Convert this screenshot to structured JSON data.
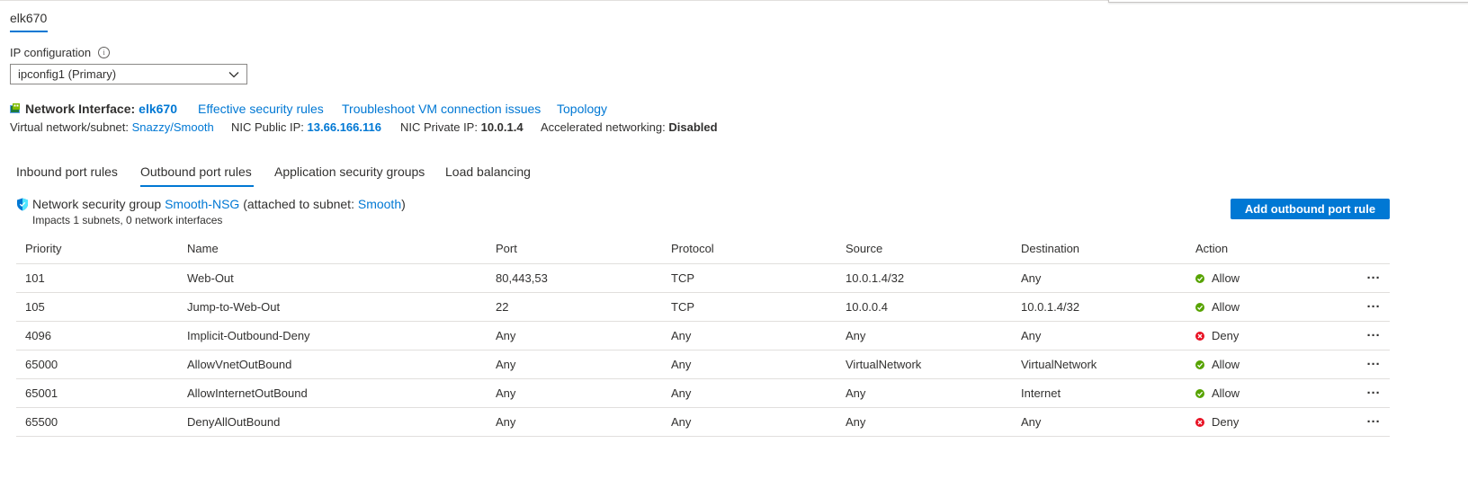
{
  "nic_tab": "elk670",
  "ip_config": {
    "label": "IP configuration",
    "selected": "ipconfig1 (Primary)"
  },
  "nic": {
    "label": "Network Interface:",
    "name": "elk670",
    "links": [
      "Effective security rules",
      "Troubleshoot VM connection issues",
      "Topology"
    ],
    "vnet_label": "Virtual network/subnet:",
    "vnet_value": "Snazzy/Smooth",
    "public_ip_label": "NIC Public IP:",
    "public_ip_value": "13.66.166.116",
    "private_ip_label": "NIC Private IP:",
    "private_ip_value": "10.0.1.4",
    "accel_label": "Accelerated networking:",
    "accel_value": "Disabled"
  },
  "tabs": [
    {
      "label": "Inbound port rules",
      "active": false
    },
    {
      "label": "Outbound port rules",
      "active": true
    },
    {
      "label": "Application security groups",
      "active": false
    },
    {
      "label": "Load balancing",
      "active": false
    }
  ],
  "nsg": {
    "prefix": "Network security group",
    "name": "Smooth-NSG",
    "attached_prefix": "(attached to subnet:",
    "subnet": "Smooth",
    "attached_suffix": ")",
    "impacts": "Impacts 1 subnets, 0 network interfaces"
  },
  "add_button": "Add outbound port rule",
  "table": {
    "headers": [
      "Priority",
      "Name",
      "Port",
      "Protocol",
      "Source",
      "Destination",
      "Action"
    ],
    "rows": [
      {
        "priority": "101",
        "name": "Web-Out",
        "port": "80,443,53",
        "protocol": "TCP",
        "source": "10.0.1.4/32",
        "destination": "Any",
        "action": "Allow",
        "more": "···"
      },
      {
        "priority": "105",
        "name": "Jump-to-Web-Out",
        "port": "22",
        "protocol": "TCP",
        "source": "10.0.0.4",
        "destination": "10.0.1.4/32",
        "action": "Allow",
        "more": "···"
      },
      {
        "priority": "4096",
        "name": "Implicit-Outbound-Deny",
        "port": "Any",
        "protocol": "Any",
        "source": "Any",
        "destination": "Any",
        "action": "Deny",
        "more": "···"
      },
      {
        "priority": "65000",
        "name": "AllowVnetOutBound",
        "port": "Any",
        "protocol": "Any",
        "source": "VirtualNetwork",
        "destination": "VirtualNetwork",
        "action": "Allow",
        "more": "···"
      },
      {
        "priority": "65001",
        "name": "AllowInternetOutBound",
        "port": "Any",
        "protocol": "Any",
        "source": "Any",
        "destination": "Internet",
        "action": "Allow",
        "more": "···"
      },
      {
        "priority": "65500",
        "name": "DenyAllOutBound",
        "port": "Any",
        "protocol": "Any",
        "source": "Any",
        "destination": "Any",
        "action": "Deny",
        "more": "···"
      }
    ]
  },
  "colors": {
    "accent": "#0078d4",
    "allow": "#57a300",
    "deny": "#e81123"
  }
}
